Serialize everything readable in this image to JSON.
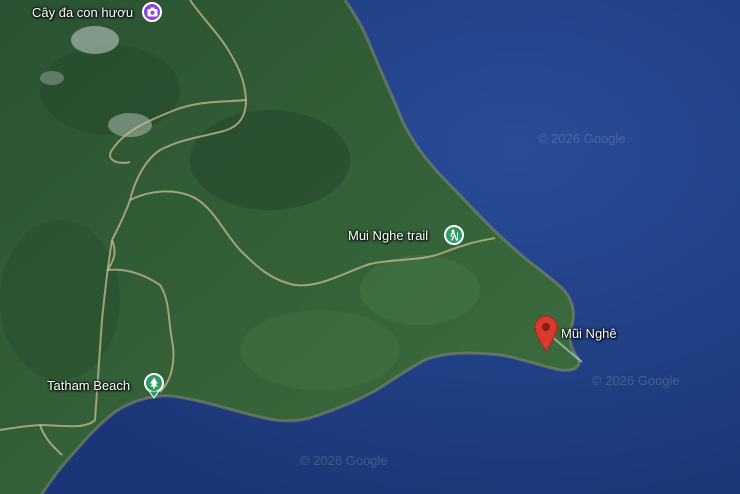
{
  "places": {
    "cay_da": "Cây đa con hươu",
    "mui_nghe_trail": "Mui Nghe trail",
    "tatham_beach": "Tatham Beach",
    "mui_nghe": "Mũi Nghê"
  },
  "watermarks": [
    "© 2026 Google",
    "© 2026 Google",
    "© 2026 Google"
  ],
  "colors": {
    "sea": "#1f3f86",
    "land": "#2f5a34",
    "photo_poi": "#8e44d9",
    "park_poi": "#2e9b64",
    "pin": "#d93a2f"
  },
  "icons": {
    "photo_poi": "camera-icon",
    "trail_poi": "hiking-icon",
    "beach_poi": "tree-icon",
    "pin": "map-pin-icon"
  }
}
